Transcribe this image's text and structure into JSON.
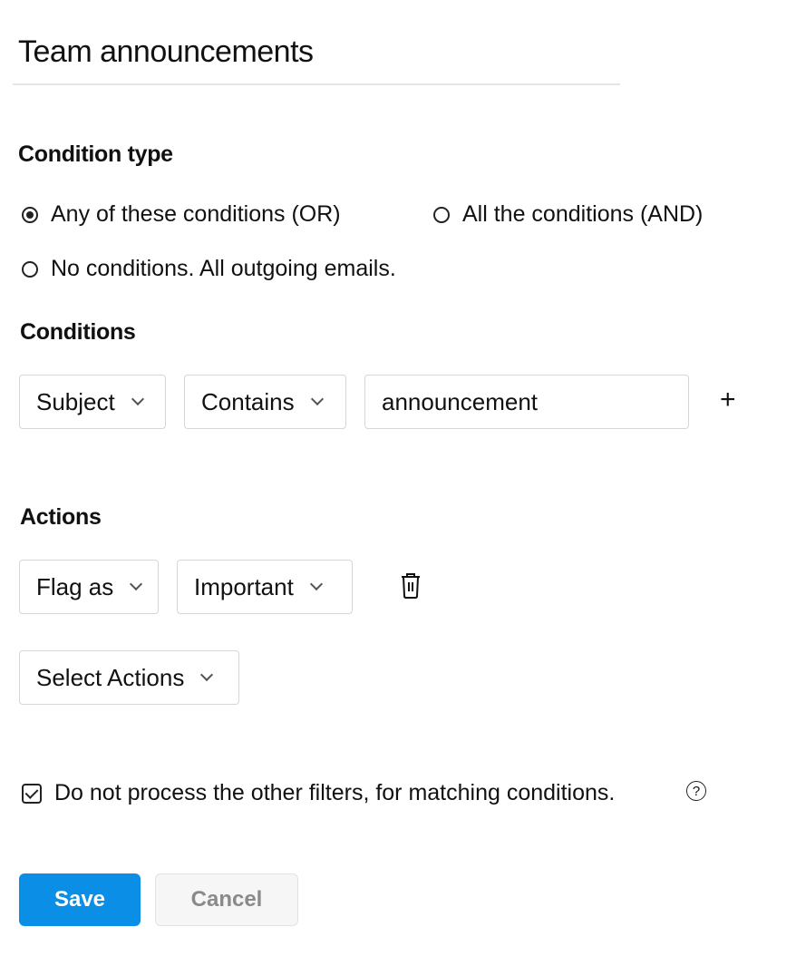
{
  "filter": {
    "name": "Team announcements"
  },
  "condition_type": {
    "label": "Condition type",
    "options": [
      {
        "label": "Any of these conditions (OR)",
        "selected": true
      },
      {
        "label": "All the conditions (AND)",
        "selected": false
      },
      {
        "label": "No conditions. All outgoing emails.",
        "selected": false
      }
    ]
  },
  "conditions": {
    "label": "Conditions",
    "rows": [
      {
        "field": "Subject",
        "operator": "Contains",
        "value": "announcement"
      }
    ],
    "add_icon": "plus-icon",
    "add_symbol": "+"
  },
  "actions": {
    "label": "Actions",
    "rows": [
      {
        "action": "Flag as",
        "value": "Important",
        "delete_icon": "trash-icon"
      }
    ],
    "select_placeholder": "Select Actions"
  },
  "stop_processing": {
    "label": "Do not process the other filters, for matching conditions.",
    "checked": true,
    "help_icon": "question-circle-icon",
    "help_symbol": "?"
  },
  "buttons": {
    "save": "Save",
    "cancel": "Cancel"
  },
  "colors": {
    "primary": "#0a8ee6",
    "border": "#d6d6d6",
    "cancel_text": "#8a8a8a"
  }
}
